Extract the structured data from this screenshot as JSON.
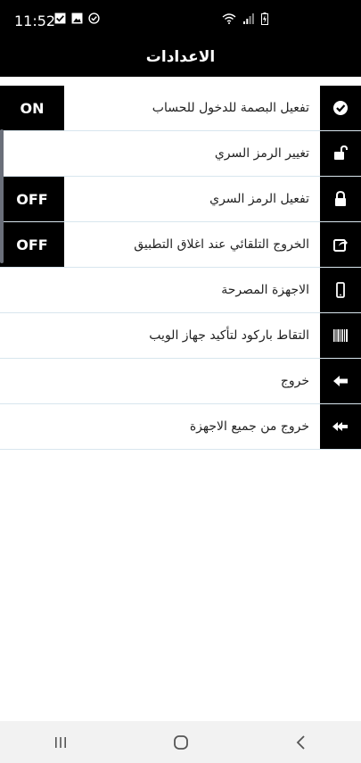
{
  "status": {
    "time": "11:52",
    "icons": [
      "checkbox-notification-icon",
      "image-notification-icon",
      "check-circle-icon",
      "wifi-icon",
      "signal-icon",
      "battery-charging-icon"
    ]
  },
  "header": {
    "title": "الاعدادات"
  },
  "settings": [
    {
      "label": "تفعيل البصمة للدخول للحساب",
      "icon": "check-circle-icon",
      "toggle": "ON"
    },
    {
      "label": "تغيير الرمز السري",
      "icon": "unlock-icon"
    },
    {
      "label": "تفعيل الرمز السري",
      "icon": "lock-icon",
      "toggle": "OFF"
    },
    {
      "label": "الخروج التلقائي عند اغلاق التطبيق",
      "icon": "share-exit-icon",
      "toggle": "OFF"
    },
    {
      "label": "الاجهزة المصرحة",
      "icon": "mobile-icon"
    },
    {
      "label": "التقاط باركود لتأكيد جهاز الويب",
      "icon": "barcode-icon"
    },
    {
      "label": "خروج",
      "icon": "arrow-left-icon"
    },
    {
      "label": "خروج من جميع الاجهزة",
      "icon": "double-arrow-left-icon"
    }
  ],
  "colors": {
    "header_bg": "#000000",
    "divider": "#d8e6ee",
    "nav_bg": "#f2f2f2"
  }
}
